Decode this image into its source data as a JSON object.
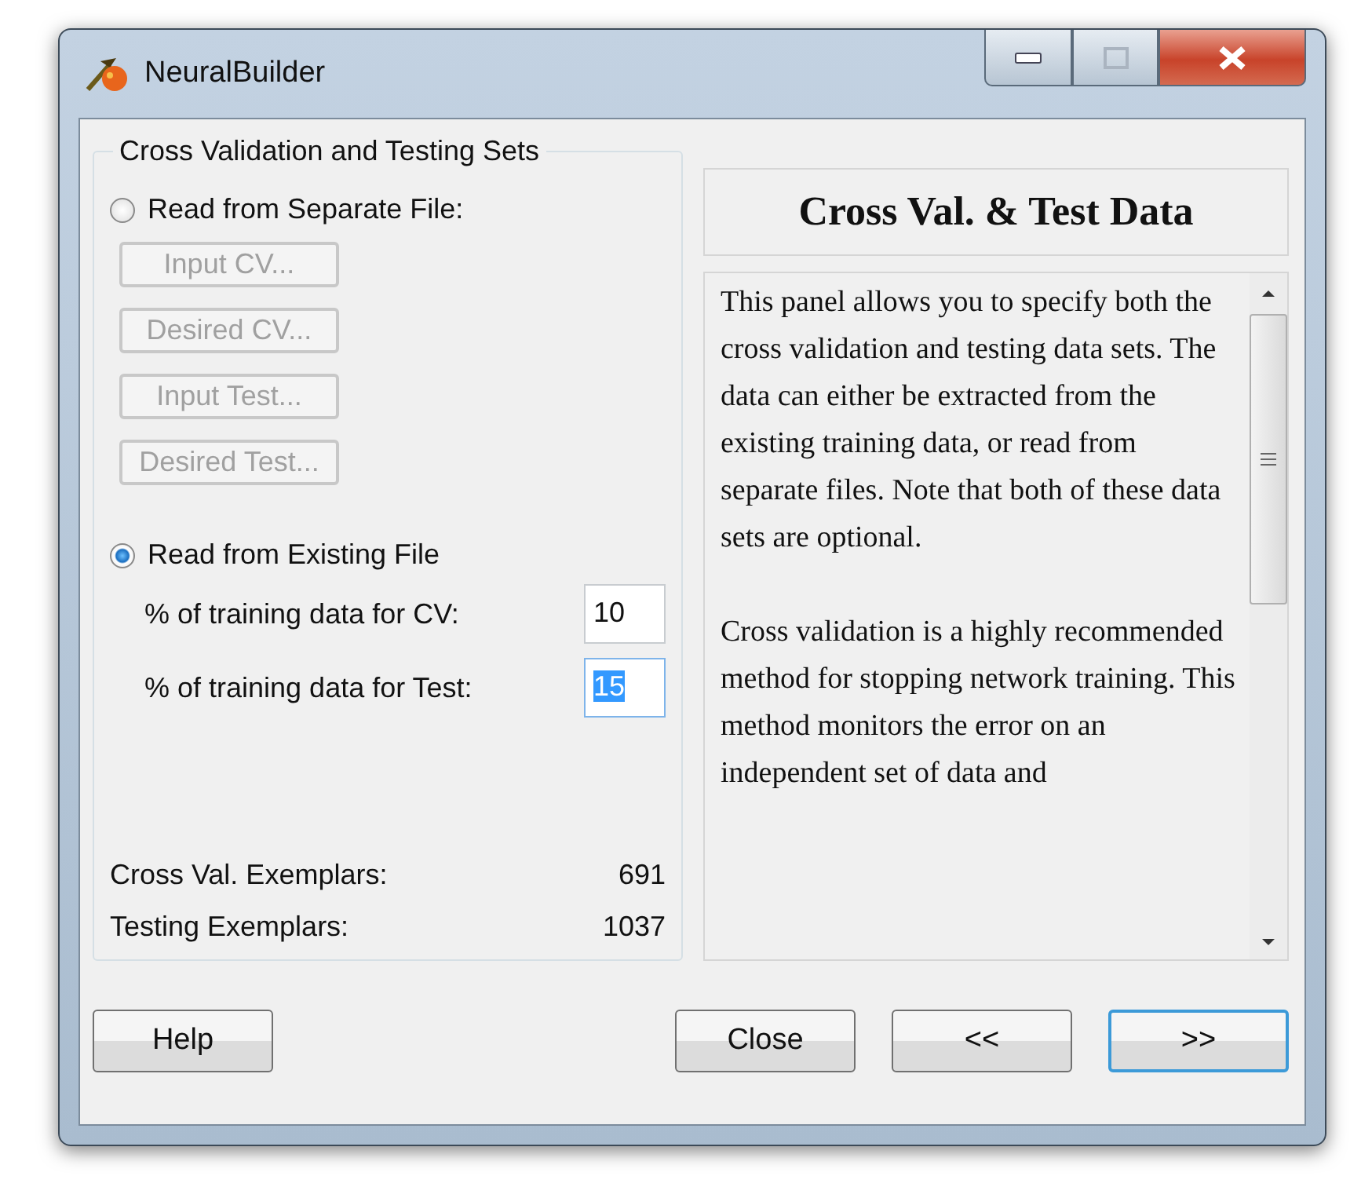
{
  "window": {
    "title": "NeuralBuilder"
  },
  "group": {
    "title": "Cross Validation and Testing Sets",
    "options": [
      {
        "label": "Read from Separate File:",
        "selected": false
      },
      {
        "label": "Read from Existing File",
        "selected": true
      }
    ],
    "file_buttons": [
      {
        "label": "Input CV...",
        "disabled": true
      },
      {
        "label": "Desired CV...",
        "disabled": true
      },
      {
        "label": "Input Test...",
        "disabled": true
      },
      {
        "label": "Desired Test...",
        "disabled": true
      }
    ],
    "fields": [
      {
        "label": "% of training data for CV:",
        "value": "10",
        "focused": false
      },
      {
        "label": "% of training data for Test:",
        "value": "15",
        "focused": true
      }
    ],
    "stats": [
      {
        "label": "Cross Val. Exemplars:",
        "value": "691"
      },
      {
        "label": "Testing Exemplars:",
        "value": "1037"
      }
    ]
  },
  "help_panel": {
    "title": "Cross Val. & Test Data",
    "paragraphs": [
      "This panel allows you to specify both the cross validation and testing data sets. The data can either be extracted from the existing training data, or read from separate files. Note that both of these data sets are optional.",
      "Cross validation is a highly recommended method for stopping network training. This method monitors the error on an independent set of data and"
    ]
  },
  "buttons": [
    {
      "label": "Help",
      "default": false
    },
    {
      "label": "Close",
      "default": false
    },
    {
      "label": "<<",
      "default": false
    },
    {
      "label": ">>",
      "default": true
    }
  ]
}
